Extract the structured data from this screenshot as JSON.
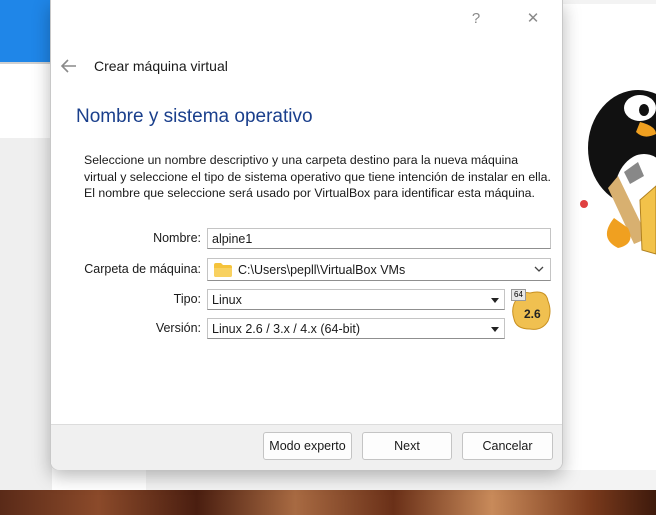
{
  "window": {
    "help_label": "?",
    "close_label": "✕"
  },
  "wizard": {
    "title": "Crear máquina virtual",
    "page_title": "Nombre y sistema operativo",
    "description": "Seleccione un nombre descriptivo y una carpeta destino para la nueva máquina virtual y seleccione el tipo de sistema operativo que tiene intención de instalar en ella. El nombre que seleccione será usado por VirtualBox para identificar esta máquina."
  },
  "form": {
    "name_label": "Nombre:",
    "name_value": "alpine1",
    "folder_label": "Carpeta de máquina:",
    "folder_value": "C:\\Users\\pepll\\VirtualBox VMs",
    "type_label": "Tipo:",
    "type_value": "Linux",
    "version_label": "Versión:",
    "version_value": "Linux 2.6 / 3.x / 4.x (64-bit)"
  },
  "os_badge": {
    "bits": "64",
    "version": "2.6"
  },
  "buttons": {
    "expert": "Modo experto",
    "next": "Next",
    "cancel": "Cancelar"
  },
  "colors": {
    "page_title": "#1a3f8c",
    "folder": "#f5c33b",
    "badge": "#f0c050"
  },
  "icons": [
    "back-arrow-icon",
    "folder-icon",
    "chevron-down-icon",
    "dropdown-arrow-icon",
    "linux-64-os-icon",
    "tux-penguin-image"
  ]
}
